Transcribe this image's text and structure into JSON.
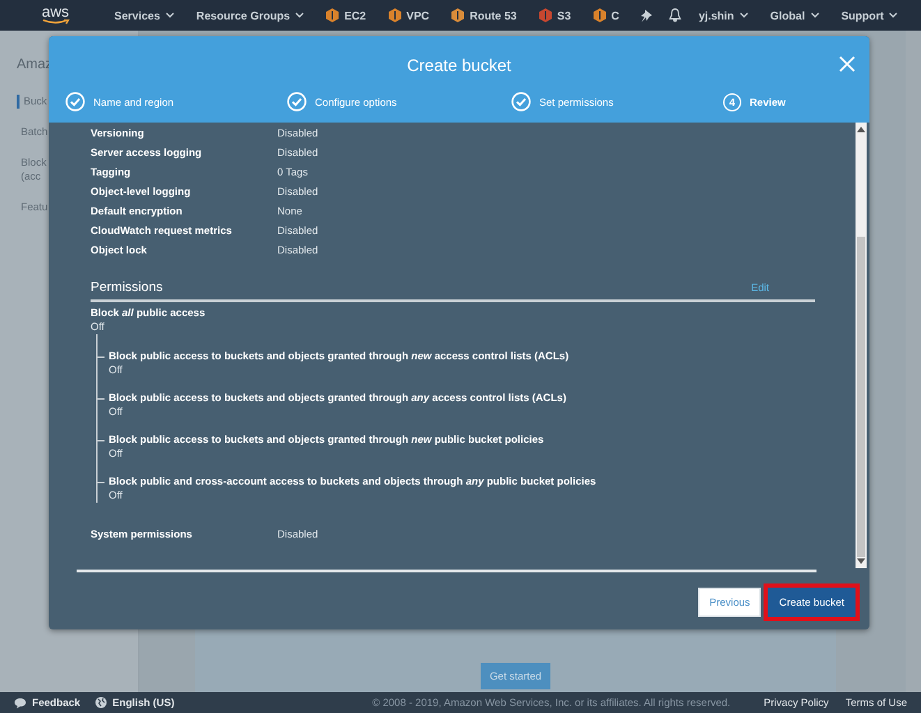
{
  "nav": {
    "logo": "aws",
    "items": [
      {
        "kind": "menu",
        "label": "Services"
      },
      {
        "kind": "menu",
        "label": "Resource Groups"
      },
      {
        "kind": "service",
        "label": "EC2",
        "color": "#d9822b"
      },
      {
        "kind": "service",
        "label": "VPC",
        "color": "#d9822b"
      },
      {
        "kind": "service",
        "label": "Route 53",
        "color": "#d98c3a"
      },
      {
        "kind": "service",
        "label": "S3",
        "color": "#c7472f"
      },
      {
        "kind": "service",
        "label": "C",
        "color": "#d9822b"
      },
      {
        "kind": "pin"
      },
      {
        "kind": "bell"
      },
      {
        "kind": "menu",
        "label": "yj.shin"
      },
      {
        "kind": "menu",
        "label": "Global"
      },
      {
        "kind": "menu",
        "label": "Support"
      }
    ]
  },
  "sidebar": {
    "title": "Amaz",
    "items": [
      {
        "label": "Buck",
        "selected": true
      },
      {
        "label": "Batch",
        "selected": false
      },
      {
        "label": "Block\n(acc",
        "selected": false
      },
      {
        "label": "Featu",
        "selected": false
      }
    ]
  },
  "background_button": "Get started",
  "dialog": {
    "title": "Create bucket",
    "steps": [
      {
        "label": "Name and region",
        "done": true,
        "selected": false
      },
      {
        "label": "Configure options",
        "done": true,
        "selected": false
      },
      {
        "label": "Set permissions",
        "done": true,
        "selected": false
      },
      {
        "label": "Review",
        "number": "4",
        "done": false,
        "selected": true
      }
    ],
    "properties": [
      {
        "label": "Versioning",
        "value": "Disabled"
      },
      {
        "label": "Server access logging",
        "value": "Disabled"
      },
      {
        "label": "Tagging",
        "value": "0 Tags"
      },
      {
        "label": "Object-level logging",
        "value": "Disabled"
      },
      {
        "label": "Default encryption",
        "value": "None"
      },
      {
        "label": "CloudWatch request metrics",
        "value": "Disabled"
      },
      {
        "label": "Object lock",
        "value": "Disabled"
      }
    ],
    "permissions": {
      "title": "Permissions",
      "edit": "Edit",
      "block_all": {
        "label": "Block *all* public access",
        "value": "Off",
        "children": [
          {
            "label": "Block public access to buckets and objects granted through *new* access control lists (ACLs)",
            "value": "Off"
          },
          {
            "label": "Block public access to buckets and objects granted through *any* access control lists (ACLs)",
            "value": "Off"
          },
          {
            "label": "Block public access to buckets and objects granted through *new* public bucket policies",
            "value": "Off"
          },
          {
            "label": "Block public and cross-account access to buckets and objects through *any* public bucket policies",
            "value": "Off"
          }
        ]
      },
      "system": {
        "label": "System permissions",
        "value": "Disabled"
      }
    },
    "buttons": [
      {
        "label": "Previous",
        "kind": "secondary"
      },
      {
        "label": "Create bucket",
        "kind": "primary",
        "highlighted": true
      }
    ]
  },
  "footer": {
    "feedback": "Feedback",
    "language": "English (US)",
    "copyright": "© 2008 - 2019, Amazon Web Services, Inc. or its affiliates. All rights reserved.",
    "links": [
      "Privacy Policy",
      "Terms of Use"
    ]
  }
}
